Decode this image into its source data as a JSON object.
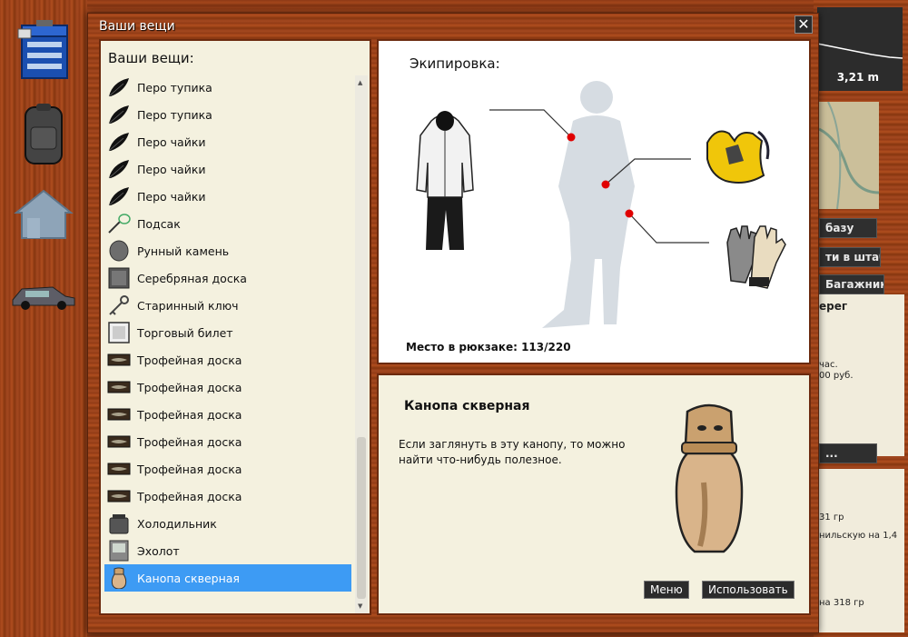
{
  "window": {
    "title": "Ваши вещи"
  },
  "items_panel": {
    "heading": "Ваши вещи:",
    "items": [
      {
        "label": "Перо тупика",
        "icon": "feather-icon"
      },
      {
        "label": "Перо тупика",
        "icon": "feather-icon"
      },
      {
        "label": "Перо чайки",
        "icon": "feather-icon"
      },
      {
        "label": "Перо чайки",
        "icon": "feather-icon"
      },
      {
        "label": "Перо чайки",
        "icon": "feather-icon"
      },
      {
        "label": "Подсак",
        "icon": "landing-net-icon"
      },
      {
        "label": "Рунный камень",
        "icon": "rune-stone-icon"
      },
      {
        "label": "Серебряная доска",
        "icon": "silver-board-icon"
      },
      {
        "label": "Старинный ключ",
        "icon": "old-key-icon"
      },
      {
        "label": "Торговый билет",
        "icon": "trade-ticket-icon"
      },
      {
        "label": "Трофейная доска",
        "icon": "trophy-board-icon"
      },
      {
        "label": "Трофейная доска",
        "icon": "trophy-board-icon"
      },
      {
        "label": "Трофейная доска",
        "icon": "trophy-board-icon"
      },
      {
        "label": "Трофейная доска",
        "icon": "trophy-board-icon"
      },
      {
        "label": "Трофейная доска",
        "icon": "trophy-board-icon"
      },
      {
        "label": "Трофейная доска",
        "icon": "trophy-board-icon"
      },
      {
        "label": "Холодильник",
        "icon": "cooler-icon"
      },
      {
        "label": "Эхолот",
        "icon": "echo-sounder-icon"
      },
      {
        "label": "Канопа скверная",
        "icon": "canopic-jar-icon",
        "selected": true
      }
    ]
  },
  "equipment": {
    "title": "Экипировка:",
    "backpack_label": "Место в рюкзаке: 113/220"
  },
  "description": {
    "name": "Канопа скверная",
    "text": "Если заглянуть в эту канопу, то можно найти что-нибудь полезное.",
    "menu_label": "Меню",
    "use_label": "Использовать"
  },
  "background": {
    "depth": "3,21 m",
    "btn_base": "базу",
    "btn_hq": "ти в штаб",
    "btn_trunk": "Багажник",
    "location": "ерег",
    "info_1": "час.",
    "info_2": "00 руб.",
    "btn_dots": "...",
    "stat_1": "31 гр",
    "stat_2": "нильскую на 1,4",
    "stat_3": "на 318 гр"
  },
  "colors": {
    "selection": "#3d9bf4",
    "wood": "#9a3f17",
    "paper": "#f4f1df",
    "marker": "#e00000"
  }
}
